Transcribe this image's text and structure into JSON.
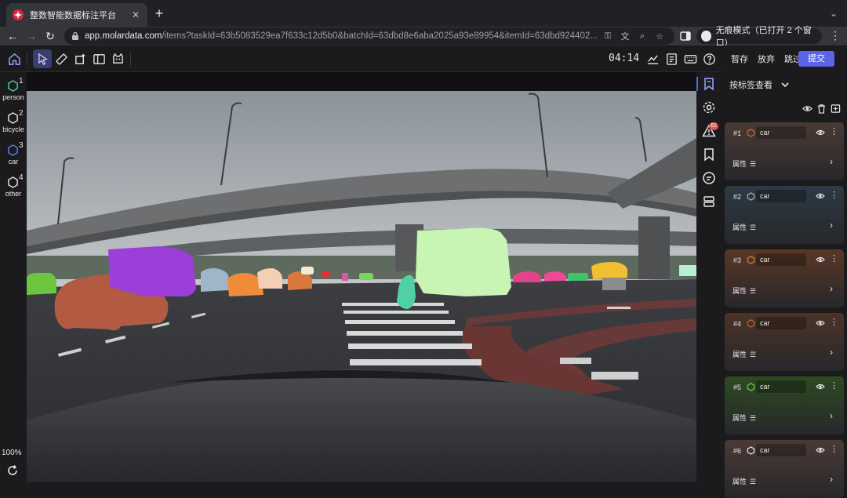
{
  "browser": {
    "tab_title": "整数智能数据标注平台",
    "tab_close": "✕",
    "new_tab": "+",
    "url_host": "app.molardata.com",
    "url_path": "/items?taskId=63b5083529ea7f633c12d5b0&batchId=63dbd8e6aba2025a93e89954&itemId=63dbd924402...",
    "incognito_label": "无痕模式（已打开 2 个窗口）"
  },
  "toolbar": {
    "timer": "04:14"
  },
  "actions": {
    "pause": "暂存",
    "discard": "放弃",
    "skip": "跳过",
    "submit": "提交"
  },
  "labels": [
    {
      "num": "1",
      "name": "person",
      "color": "#4fd1a5"
    },
    {
      "num": "2",
      "name": "bicycle",
      "color": "#e8e8e8"
    },
    {
      "num": "3",
      "name": "car",
      "color": "#6a7cf0"
    },
    {
      "num": "4",
      "name": "other",
      "color": "#e8e8e8"
    }
  ],
  "zoom": "100%",
  "warning_count": "61",
  "panel": {
    "view_mode": "按标签查看",
    "attr_label": "属性",
    "attr_icon": "☰",
    "annotations": [
      {
        "index": "#1",
        "class": "car",
        "hex_color": "#c0703a"
      },
      {
        "index": "#2",
        "class": "car",
        "hex_color": "#9fb6c8"
      },
      {
        "index": "#3",
        "class": "car",
        "hex_color": "#e07a38"
      },
      {
        "index": "#4",
        "class": "car",
        "hex_color": "#c0683a"
      },
      {
        "index": "#5",
        "class": "car",
        "hex_color": "#7ac94a"
      },
      {
        "index": "#6",
        "class": "car",
        "hex_color": "#e8e8e8"
      }
    ]
  },
  "colors": {
    "accent": "#5b63e6",
    "card_colors": [
      "#4a3a34",
      "#2c3a44",
      "#5a3726",
      "#4c3328",
      "#2e4a22",
      "#4a3a36"
    ]
  }
}
